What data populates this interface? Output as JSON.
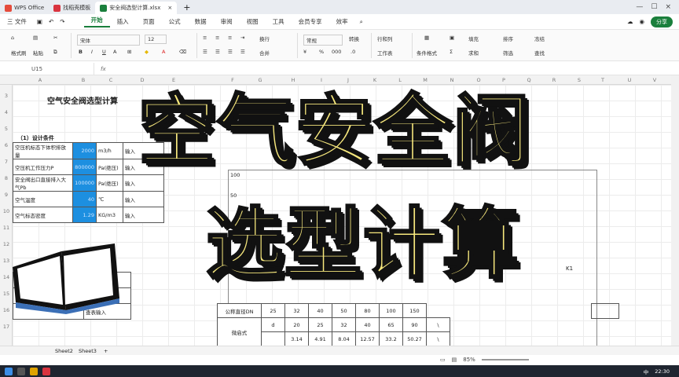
{
  "window": {
    "tabs": [
      {
        "label": "WPS Office",
        "color": "#e54b3b"
      },
      {
        "label": "找稻壳模板",
        "color": "#d9343f"
      },
      {
        "label": "安全阀选型计算.xlsx",
        "color": "#1a7f3c"
      }
    ]
  },
  "menu": {
    "file_label": "三 文件",
    "items": [
      "开始",
      "插入",
      "页面",
      "公式",
      "数据",
      "审阅",
      "视图",
      "工具",
      "会员专享",
      "效率"
    ],
    "share_label": "分享"
  },
  "ribbon": {
    "format_painter": "格式刷",
    "paste": "粘贴",
    "font_name": "宋体",
    "font_size": "12",
    "wrap": "换行",
    "number_format": "常规",
    "convert": "转换",
    "row_col": "行和列",
    "fill": "填充",
    "sort": "排序",
    "freeze": "冻结",
    "merge": "合并",
    "worksheet": "工作表",
    "cond_format": "条件格式",
    "sum": "求和",
    "filter": "筛选",
    "find": "查找",
    "percent": "%",
    "thousands": "000"
  },
  "formula_bar": {
    "cell": "U15",
    "fx": "fx",
    "value": ""
  },
  "columns": [
    "A",
    "B",
    "C",
    "D",
    "E",
    "F",
    "G",
    "H",
    "I",
    "J",
    "K",
    "L",
    "M",
    "N",
    "O",
    "P",
    "Q",
    "R",
    "S",
    "T",
    "U",
    "V"
  ],
  "rows": [
    "3",
    "4",
    "5",
    "6",
    "7",
    "8",
    "9",
    "10",
    "11",
    "12",
    "13",
    "14",
    "15",
    "16",
    "17"
  ],
  "sheet": {
    "title": "空气安全阀选型计算",
    "section1": "（1）设计条件",
    "params": [
      {
        "name": "空压机标态下体积排放量",
        "value": "2000",
        "unit": "m3/h",
        "note": "输入"
      },
      {
        "name": "空压机工作压力P",
        "value": "800000",
        "unit": "Pa(绝压)",
        "note": "输入"
      },
      {
        "name": "安全阀出口直接排入大气Pb",
        "value": "100000",
        "unit": "Pa(绝压)",
        "note": "输入"
      },
      {
        "name": "空气温度",
        "value": "40",
        "unit": "℃",
        "note": "输入"
      },
      {
        "name": "空气标态密度",
        "value": "1.29",
        "unit": "KG/m3",
        "note": "输入"
      }
    ],
    "lower_labels": [
      "（过程）",
      "计算",
      "查表输入"
    ],
    "dn_table": {
      "row1_label": "公称直径DN",
      "row1": [
        "25",
        "32",
        "40",
        "50",
        "80",
        "100",
        "150"
      ],
      "row2_label": "微启式",
      "row2_sub": "d",
      "row2": [
        "20",
        "25",
        "32",
        "40",
        "65",
        "90",
        "\\"
      ],
      "row3": [
        "3.14",
        "4.91",
        "8.04",
        "12.57",
        "33.2",
        "50.27",
        "\\"
      ]
    },
    "chart_tick_100": "100",
    "chart_tick_50": "50",
    "k1_label": "K1"
  },
  "sheet_tabs": [
    "Sheet2",
    "Sheet3",
    "+"
  ],
  "status": {
    "input_mode": "中",
    "zoom": "85%"
  },
  "taskbar": {
    "time": "22:30"
  },
  "overlay": {
    "line1": "空气安全阀",
    "line2": "选型计算",
    "text_color": "#f7e87d"
  }
}
